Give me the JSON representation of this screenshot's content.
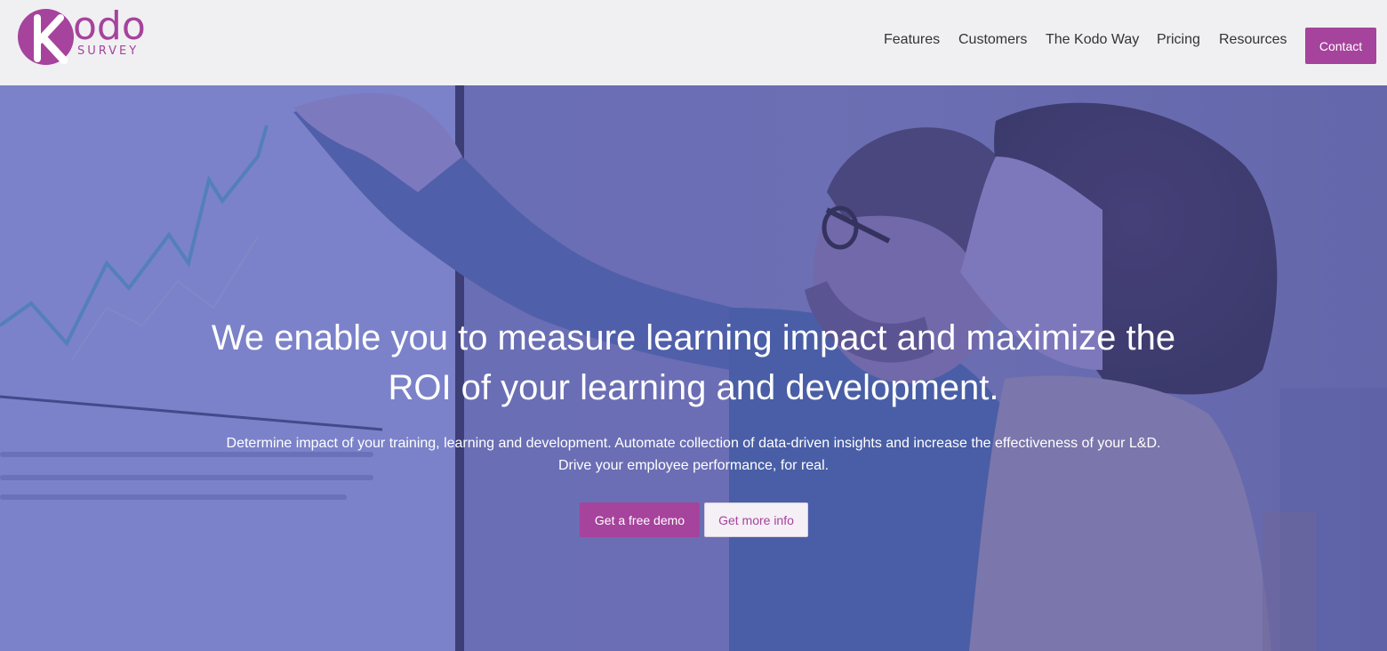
{
  "brand": {
    "name": "Kodo Survey",
    "logo_letter": "K",
    "logo_word": "odo",
    "logo_sub": "SURVEY",
    "color": "#a6439c"
  },
  "nav": {
    "items": [
      "Features",
      "Customers",
      "The Kodo Way",
      "Pricing",
      "Resources"
    ],
    "contact_label": "Contact"
  },
  "hero": {
    "headline_line1": "We enable you to measure learning impact and maximize the",
    "headline_line2": "ROI of your learning and development.",
    "sub_line1": "Determine impact of your training, learning and development. Automate collection of data-driven insights and increase the effectiveness of your L&D.",
    "sub_line2": "Drive your employee performance, for real.",
    "demo_label": "Get a free demo",
    "info_label": "Get more info"
  }
}
